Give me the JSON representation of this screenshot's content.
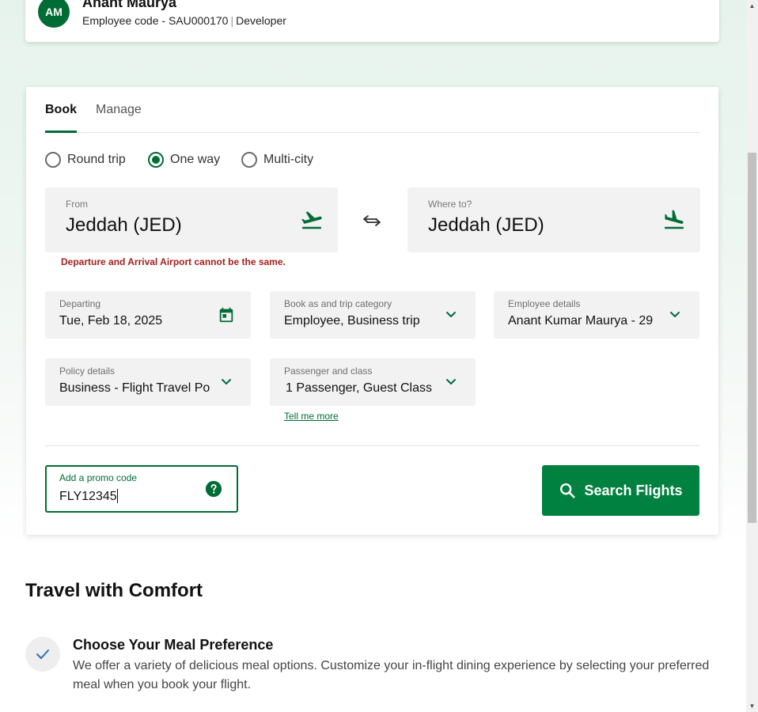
{
  "profile": {
    "initials": "AM",
    "name": "Anant Maurya",
    "employee_code": "Employee code - SAU000170",
    "separator": "|",
    "role": "Developer"
  },
  "tabs": [
    {
      "label": "Book",
      "active": true
    },
    {
      "label": "Manage",
      "active": false
    }
  ],
  "trip_types": [
    {
      "label": "Round trip",
      "checked": false
    },
    {
      "label": "One way",
      "checked": true
    },
    {
      "label": "Multi-city",
      "checked": false
    }
  ],
  "from": {
    "label": "From",
    "value": "Jeddah (JED)",
    "icon": "plane-departure-icon"
  },
  "to": {
    "label": "Where to?",
    "value": "Jeddah (JED)",
    "icon": "plane-arrival-icon"
  },
  "error": "Departure and Arrival Airport cannot be the same.",
  "departing": {
    "label": "Departing",
    "value": "Tue, Feb 18, 2025"
  },
  "book_as": {
    "label": "Book as and trip category",
    "value": "Employee, Business trip"
  },
  "employee": {
    "label": "Employee details",
    "value": "Anant Kumar Maurya - 29"
  },
  "policy": {
    "label": "Policy details",
    "value": "Business - Flight Travel Po"
  },
  "passenger": {
    "label": "Passenger and class",
    "value": "1 Passenger, Guest Class"
  },
  "tell_more": "Tell me more",
  "promo": {
    "label": "Add a promo code",
    "value": "FLY12345"
  },
  "search_button": "Search Flights",
  "comfort": {
    "title": "Travel with Comfort",
    "meal_title": "Choose Your Meal Preference",
    "meal_desc": "We offer a variety of delicious meal options. Customize your in-flight dining experience by selecting your preferred meal when you book your flight."
  },
  "colors": {
    "brand_green": "#006c35",
    "button_green": "#00813f",
    "error_red": "#a32020"
  }
}
